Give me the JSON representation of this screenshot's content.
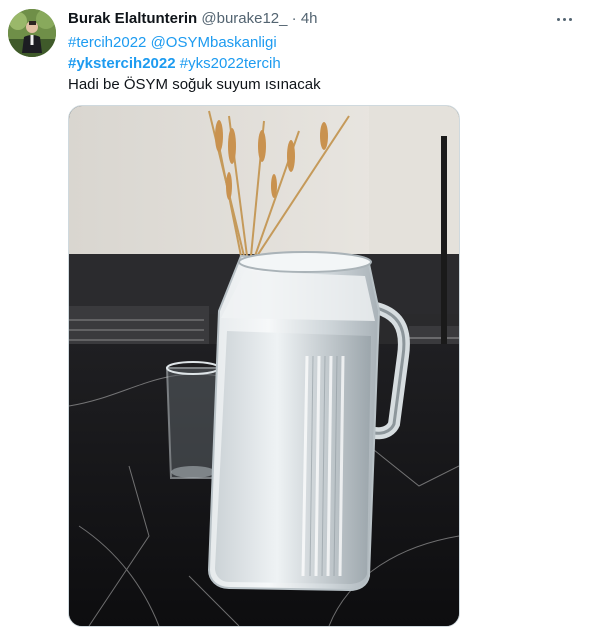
{
  "tweet": {
    "author_name": "Burak Elaltunterin",
    "author_handle": "@burake12_",
    "separator": "·",
    "time": "4h",
    "line1": {
      "tag1": "#tercih2022",
      "mention": "@OSYMbaskanligi"
    },
    "line2": {
      "tag1": "#ykstercih2022",
      "tag2": "#yks2022tercih"
    },
    "line3": "Hadi be ÖSYM soğuk suyum ısınacak"
  },
  "icons": {
    "more": "more-horizontal-icon",
    "avatar": "avatar-image"
  },
  "colors": {
    "link": "#1d9bf0",
    "secondary_text": "#536471",
    "primary_text": "#0f1419",
    "border": "#cfd9de"
  }
}
